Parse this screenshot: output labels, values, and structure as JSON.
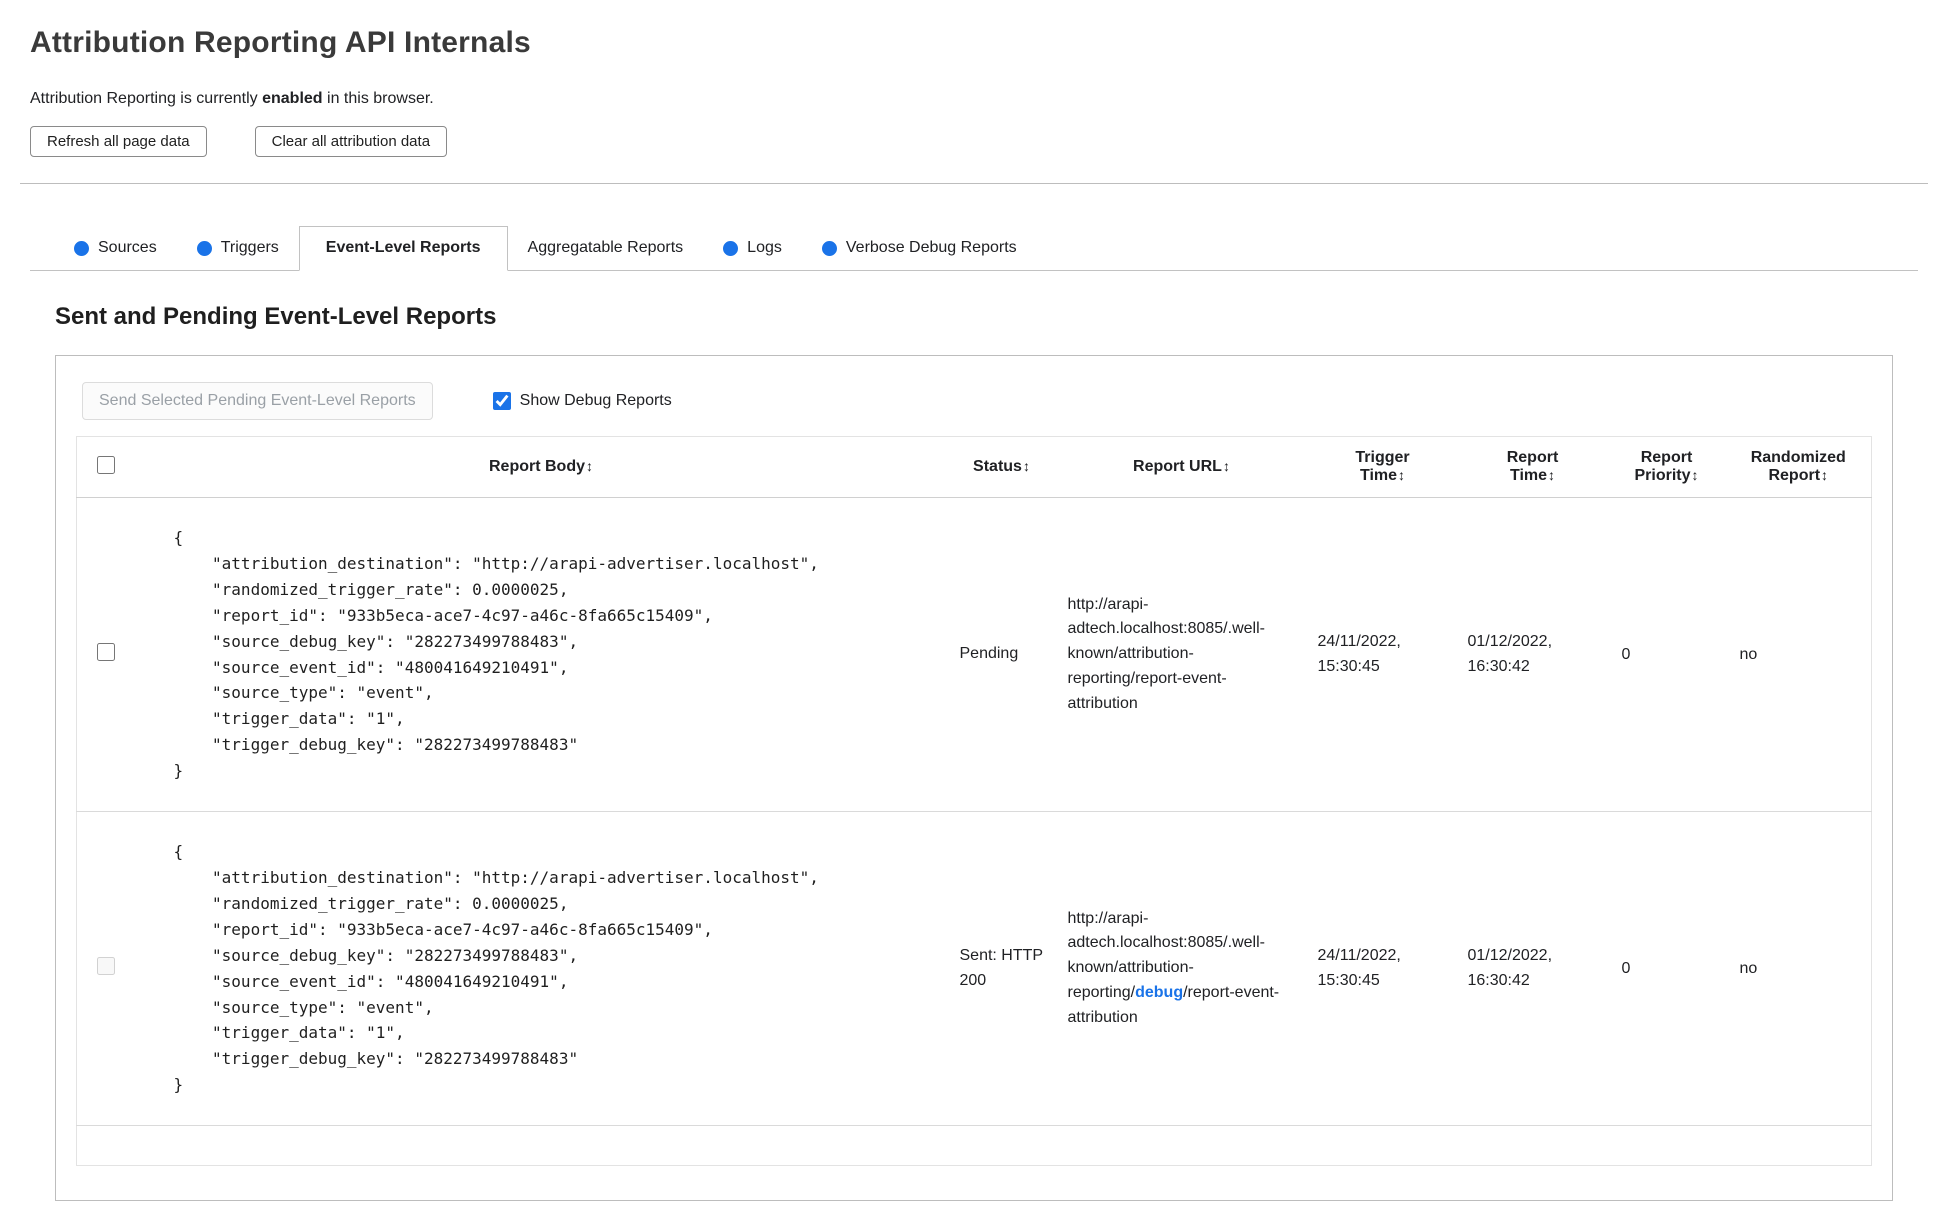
{
  "page": {
    "title": "Attribution Reporting API Internals",
    "status_prefix": "Attribution Reporting is currently ",
    "status_bold": "enabled",
    "status_suffix": " in this browser.",
    "buttons": {
      "refresh": "Refresh all page data",
      "clear": "Clear all attribution data"
    }
  },
  "tabs": [
    {
      "label": "Sources"
    },
    {
      "label": "Triggers"
    },
    {
      "label": "Event-Level Reports"
    },
    {
      "label": "Aggregatable Reports"
    },
    {
      "label": "Logs"
    },
    {
      "label": "Verbose Debug Reports"
    }
  ],
  "section": {
    "heading": "Sent and Pending Event-Level Reports",
    "send_button": "Send Selected Pending Event-Level Reports",
    "show_debug_label": "Show Debug Reports",
    "show_debug_checked": true
  },
  "table": {
    "sort_icon": "↕",
    "headers": {
      "body": "Report Body",
      "status": "Status",
      "url": "Report URL",
      "trigger_time": "Trigger Time",
      "report_time": "Report Time",
      "priority": "Report Priority",
      "randomized": "Randomized Report"
    },
    "rows": [
      {
        "body": "{\n    \"attribution_destination\": \"http://arapi-advertiser.localhost\",\n    \"randomized_trigger_rate\": 0.0000025,\n    \"report_id\": \"933b5eca-ace7-4c97-a46c-8fa665c15409\",\n    \"source_debug_key\": \"282273499788483\",\n    \"source_event_id\": \"480041649210491\",\n    \"source_type\": \"event\",\n    \"trigger_data\": \"1\",\n    \"trigger_debug_key\": \"282273499788483\"\n}",
        "status": "Pending",
        "url_pre": "http://arapi-adtech.localhost:8085/.well-known/attribution-reporting/report-event-attribution",
        "url_debug": "",
        "url_post": "",
        "trigger_time": "24/11/2022, 15:30:45",
        "report_time": "01/12/2022, 16:30:42",
        "priority": "0",
        "randomized": "no"
      },
      {
        "body": "{\n    \"attribution_destination\": \"http://arapi-advertiser.localhost\",\n    \"randomized_trigger_rate\": 0.0000025,\n    \"report_id\": \"933b5eca-ace7-4c97-a46c-8fa665c15409\",\n    \"source_debug_key\": \"282273499788483\",\n    \"source_event_id\": \"480041649210491\",\n    \"source_type\": \"event\",\n    \"trigger_data\": \"1\",\n    \"trigger_debug_key\": \"282273499788483\"\n}",
        "status": "Sent: HTTP 200",
        "url_pre": "http://arapi-adtech.localhost:8085/.well-known/attribution-reporting/",
        "url_debug": "debug",
        "url_post": "/report-event-attribution",
        "trigger_time": "24/11/2022, 15:30:45",
        "report_time": "01/12/2022, 16:30:42",
        "priority": "0",
        "randomized": "no"
      }
    ]
  },
  "colors": {
    "accent_blue": "#1a73e8",
    "text": "#202124",
    "panel_border": "#bdbdbd"
  }
}
